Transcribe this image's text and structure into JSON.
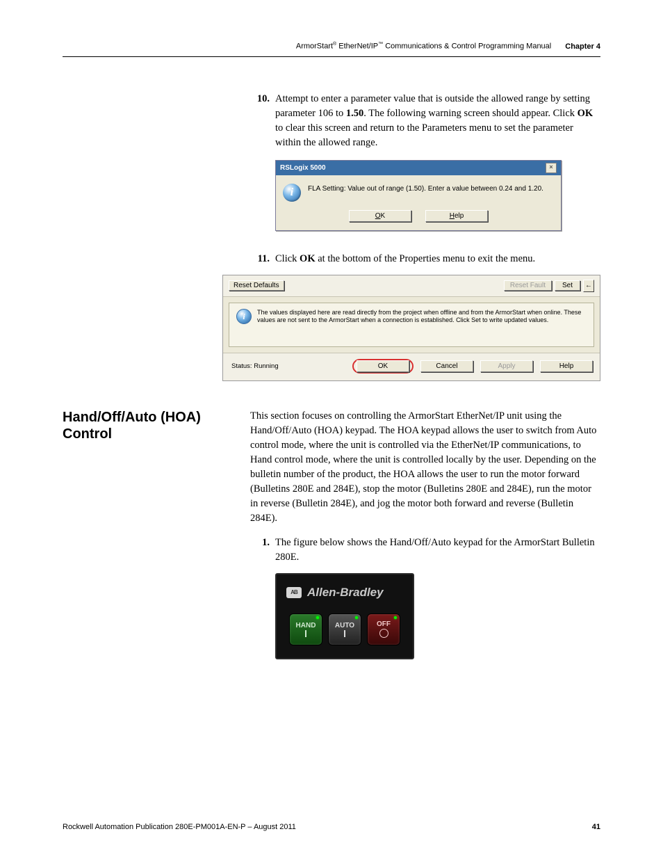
{
  "header": {
    "product_prefix": "ArmorStart",
    "reg1": "®",
    "product_mid": " EtherNet/IP",
    "reg2": "™",
    "product_suffix": " Communications & Control Programming Manual",
    "chapter": "Chapter 4"
  },
  "step10": {
    "num": "10.",
    "text_before": "Attempt to enter a parameter value that is outside the allowed range by setting parameter 106 to ",
    "bold1": "1.50",
    "text_mid": ". The following warning screen should appear. Click ",
    "bold2": "OK",
    "text_after": " to clear this screen and return to the Parameters menu to set the parameter within the allowed range."
  },
  "dialog1": {
    "title": "RSLogix 5000",
    "close_glyph": "×",
    "icon_glyph": "i",
    "message": "FLA Setting:  Value out of range (1.50).  Enter a value between 0.24 and 1.20.",
    "ok_ul": "O",
    "ok_rest": "K",
    "help_ul": "H",
    "help_rest": "elp"
  },
  "step11": {
    "num": "11.",
    "text_before": "Click ",
    "bold": "OK",
    "text_after": " at the bottom of the Properties menu to exit the menu."
  },
  "panel2": {
    "reset_defaults": "Reset Defaults",
    "reset_fault": "Reset Fault",
    "set": "Set",
    "back_glyph": "←",
    "info_icon": "i",
    "info_text": "The values displayed here are read directly from the project when offline and from the ArmorStart when online. These values are not sent to the ArmorStart when a connection is established.  Click Set to write updated values.",
    "status_label": "Status:  Running",
    "ok": "OK",
    "cancel": "Cancel",
    "apply": "Apply",
    "help": "Help"
  },
  "section": {
    "heading": "Hand/Off/Auto (HOA) Control",
    "para": "This section focuses on controlling the ArmorStart EtherNet/IP unit using the Hand/Off/Auto (HOA) keypad. The HOA keypad allows the user to switch from Auto control mode, where the unit is controlled via the EtherNet/IP communications, to Hand control mode, where the unit is controlled locally by the user. Depending on the bulletin number of the product, the HOA allows the user to run the motor forward (Bulletins 280E and 284E), stop the motor (Bulletins 280E and 284E), run the motor in reverse (Bulletin 284E), and jog the motor both forward and reverse (Bulletin 284E)."
  },
  "step1": {
    "num": "1.",
    "text": "The figure below shows the Hand/Off/Auto keypad for the ArmorStart Bulletin 280E."
  },
  "keypad": {
    "logo_text": "AB",
    "brand": "Allen-Bradley",
    "hand": "HAND",
    "auto": "AUTO",
    "off": "OFF"
  },
  "footer": {
    "pub": "Rockwell Automation Publication 280E-PM001A-EN-P – August 2011",
    "page": "41"
  }
}
